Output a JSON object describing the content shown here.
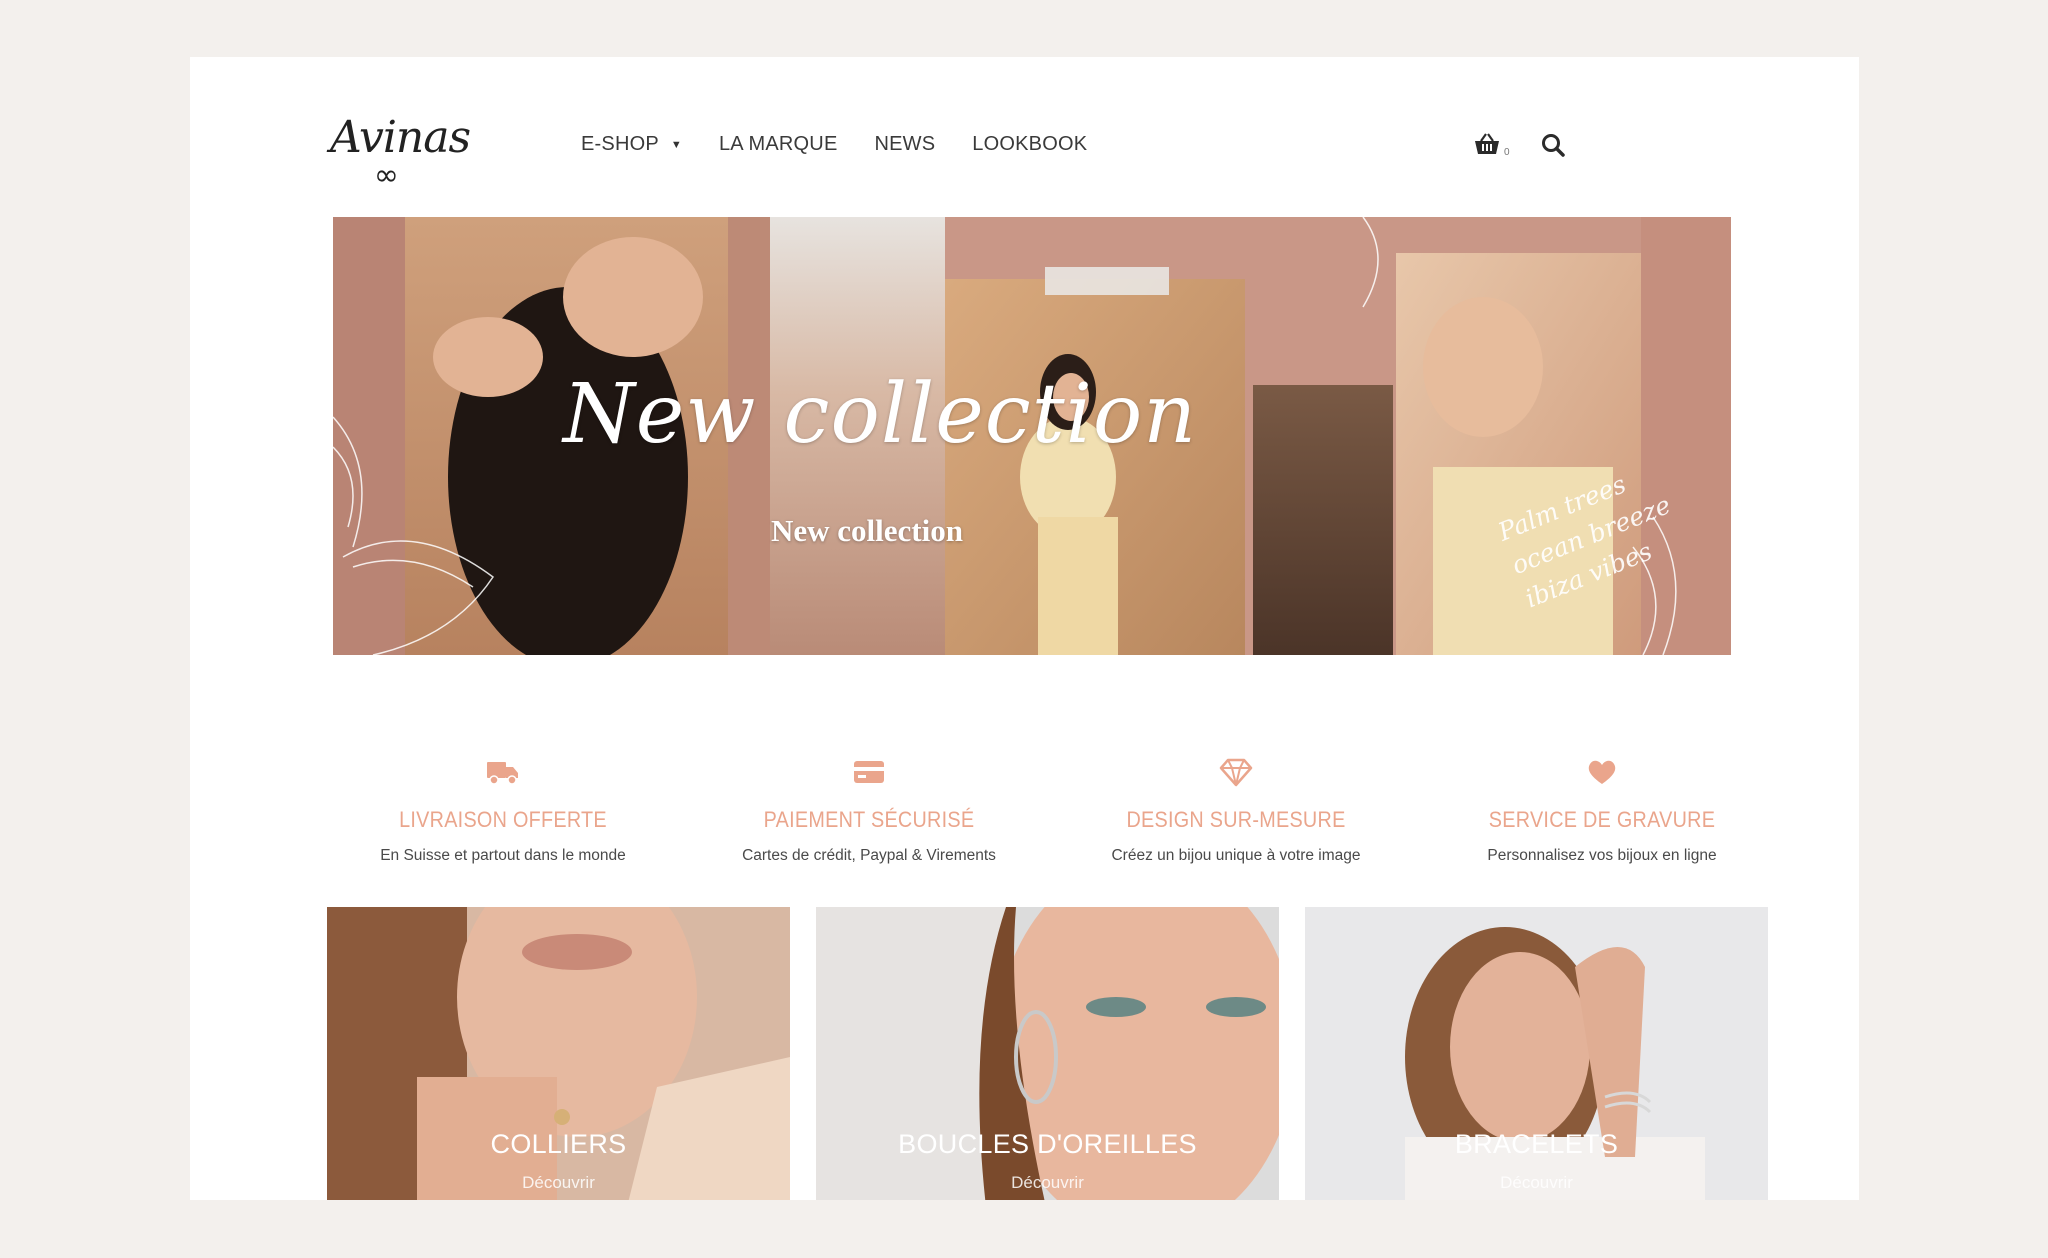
{
  "brand": {
    "logo_text": "Avinas",
    "logo_symbol": "∞"
  },
  "nav": {
    "items": [
      {
        "label": "E-SHOP",
        "has_dropdown": true
      },
      {
        "label": "LA MARQUE"
      },
      {
        "label": "NEWS"
      },
      {
        "label": "LOOKBOOK"
      }
    ]
  },
  "header": {
    "cart_count": "0",
    "cart_icon": "basket-icon",
    "search_icon": "search-icon"
  },
  "hero": {
    "script_title": "New collection",
    "subtitle": "New collection",
    "palm_lines": [
      "Palm trees",
      "ocean breeze",
      "ibiza vibes"
    ]
  },
  "features": [
    {
      "icon": "truck-icon",
      "title": "LIVRAISON OFFERTE",
      "desc": "En Suisse et partout dans le monde"
    },
    {
      "icon": "credit-card-icon",
      "title": "PAIEMENT SÉCURISÉ",
      "desc": "Cartes de crédit, Paypal & Virements"
    },
    {
      "icon": "diamond-icon",
      "title": "DESIGN SUR-MESURE",
      "desc": "Créez un bijou unique à votre image"
    },
    {
      "icon": "heart-icon",
      "title": "SERVICE DE GRAVURE",
      "desc": "Personnalisez vos bijoux en ligne"
    }
  ],
  "categories": [
    {
      "title": "COLLIERS",
      "link": "Découvrir"
    },
    {
      "title": "BOUCLES D'OREILLES",
      "link": "Découvrir"
    },
    {
      "title": "BRACELETS",
      "link": "Découvrir"
    }
  ],
  "colors": {
    "accent": "#eaa58c",
    "text": "#3a3a3a",
    "background": "#f3f0ed"
  }
}
